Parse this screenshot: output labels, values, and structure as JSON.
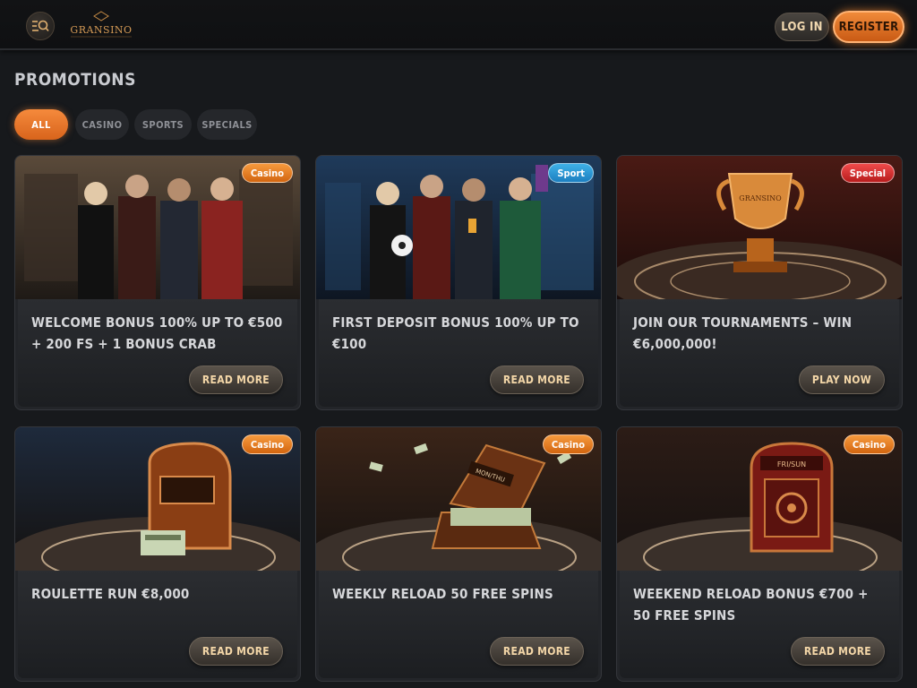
{
  "header": {
    "logo_text": "GRANSINO",
    "login_label": "LOG IN",
    "register_label": "REGISTER"
  },
  "page": {
    "title": "PROMOTIONS"
  },
  "filters": [
    {
      "label": "ALL",
      "active": true
    },
    {
      "label": "CASINO",
      "active": false
    },
    {
      "label": "SPORTS",
      "active": false
    },
    {
      "label": "SPECIALS",
      "active": false
    }
  ],
  "promotions": [
    {
      "title": "WELCOME BONUS 100% UP TO €500 + 200 FS + 1 BONUS CRAB",
      "badge": "Casino",
      "button": "READ MORE",
      "image": "group-of-four-people"
    },
    {
      "title": "FIRST DEPOSIT BONUS 100% UP TO €100",
      "badge": "Sport",
      "button": "READ MORE",
      "image": "group-with-football"
    },
    {
      "title": "JOIN OUR TOURNAMENTS – WIN €6,000,000!",
      "badge": "Special",
      "button": "PLAY NOW",
      "image": "golden-trophy"
    },
    {
      "title": "ROULETTE RUN €8,000",
      "badge": "Casino",
      "button": "READ MORE",
      "image": "slot-machine-with-cash"
    },
    {
      "title": "WEEKLY RELOAD 50 FREE SPINS",
      "badge": "Casino",
      "button": "READ MORE",
      "image": "suitcase-of-money"
    },
    {
      "title": "WEEKEND RELOAD BONUS €700 + 50 FREE SPINS",
      "badge": "Casino",
      "button": "READ MORE",
      "image": "safe-vault"
    }
  ],
  "image_labels": {
    "trophy_text": "GRANSINO",
    "suitcase_text": "MON/THU",
    "safe_text": "FRI/SUN"
  },
  "colors": {
    "accent": "#f58a3c",
    "casino_badge": "#e27a26",
    "sport_badge": "#2c97d4",
    "special_badge": "#d93030",
    "background": "#17191c"
  }
}
